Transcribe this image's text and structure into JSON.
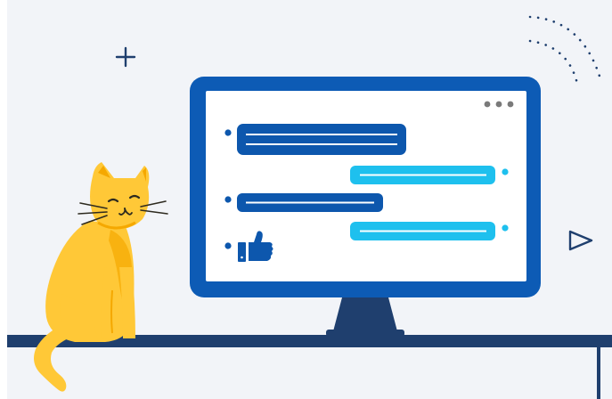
{
  "illustration": {
    "colors": {
      "background": "#f2f4f8",
      "shelf": "#1f3f6e",
      "monitor_frame": "#0d5bb5",
      "monitor_stand": "#1f3f6e",
      "screen": "#ffffff",
      "bubble_dark": "#0d57ad",
      "bubble_light": "#1ec0ee",
      "cat_body": "#ffc837",
      "cat_shade": "#f5a800",
      "cat_outline": "#2d2a1f"
    },
    "icons": [
      "plus-icon",
      "play-triangle-icon",
      "dotted-arcs",
      "window-dots-icon",
      "thumbs-up-icon"
    ],
    "chat_messages": [
      {
        "side": "left",
        "style": "dark",
        "lines": 2
      },
      {
        "side": "right",
        "style": "light",
        "lines": 1
      },
      {
        "side": "left",
        "style": "dark",
        "lines": 1
      },
      {
        "side": "right",
        "style": "light",
        "lines": 1
      },
      {
        "side": "left",
        "style": "thumbs-up",
        "lines": 0
      }
    ]
  }
}
